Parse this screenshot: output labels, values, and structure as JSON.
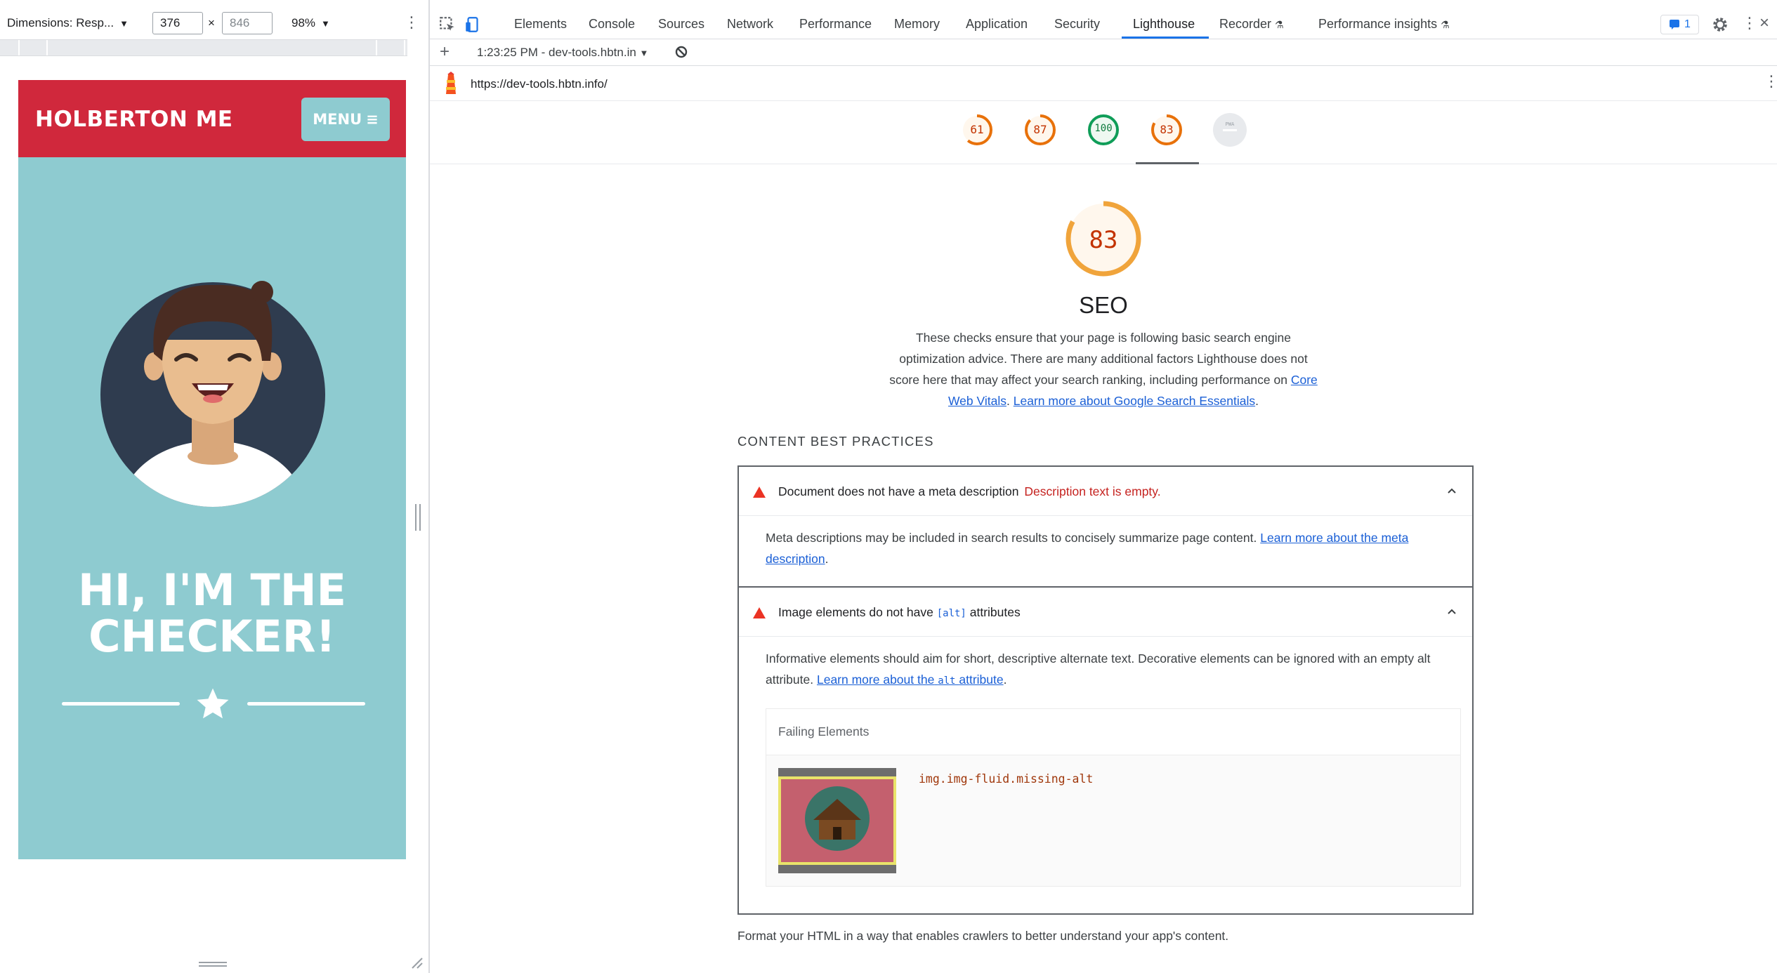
{
  "device_toolbar": {
    "dimensions_label": "Dimensions: Resp...",
    "width": "376",
    "height": "846",
    "dim_separator": "×",
    "zoom": "98%"
  },
  "site": {
    "logo": "HOLBERTON ME",
    "menu_label": "MENU",
    "hero_line1": "HI, I'M THE",
    "hero_line2": "CHECKER!",
    "colors": {
      "header": "#d0283c",
      "hero": "#8ecbd0"
    }
  },
  "devtools": {
    "tabs": [
      "Elements",
      "Console",
      "Sources",
      "Network",
      "Performance",
      "Memory",
      "Application",
      "Security",
      "Lighthouse",
      "Recorder",
      "Performance insights"
    ],
    "active_tab": "Lighthouse",
    "issues_count": "1",
    "report_select": "1:23:25 PM - dev-tools.hbtn.in",
    "report_url": "https://dev-tools.hbtn.info/"
  },
  "lighthouse": {
    "gauges": [
      {
        "score": "61",
        "color": "#e8710a",
        "fill": 0.61
      },
      {
        "score": "87",
        "color": "#e8710a",
        "fill": 0.87
      },
      {
        "score": "100",
        "color": "#0f9d58",
        "fill": 1.0
      },
      {
        "score": "83",
        "color": "#e8710a",
        "fill": 0.83
      },
      {
        "score": "PWA",
        "color": "#9aa0a6",
        "fill": 0
      }
    ],
    "category": {
      "score": "83",
      "title": "SEO",
      "desc_text": "These checks ensure that your page is following basic search engine optimization advice. There are many additional factors Lighthouse does not score here that may affect your search ranking, including performance on",
      "link1": "Core Web Vitals",
      "link_sep": ".",
      "link2": "Learn more about Google Search Essentials",
      "link_end": "."
    },
    "group_title": "CONTENT BEST PRACTICES",
    "audits": [
      {
        "title": "Document does not have a meta description",
        "display_value": "Description text is empty.",
        "desc": "Meta descriptions may be included in search results to concisely summarize page content.",
        "link": "Learn more about the meta description",
        "link_end": "."
      },
      {
        "title_pre": "Image elements do not have",
        "title_code": "[alt]",
        "title_post": "attributes",
        "desc": "Informative elements should aim for short, descriptive alternate text. Decorative elements can be ignored with an empty alt attribute.",
        "link_pre": "Learn more about the",
        "link_code": "alt",
        "link_post": "attribute",
        "link_end": ".",
        "failing_label": "Failing Elements",
        "failing_selector": "img.img-fluid.missing-alt"
      }
    ],
    "group_footer": "Format your HTML in a way that enables crawlers to better understand your app's content."
  }
}
